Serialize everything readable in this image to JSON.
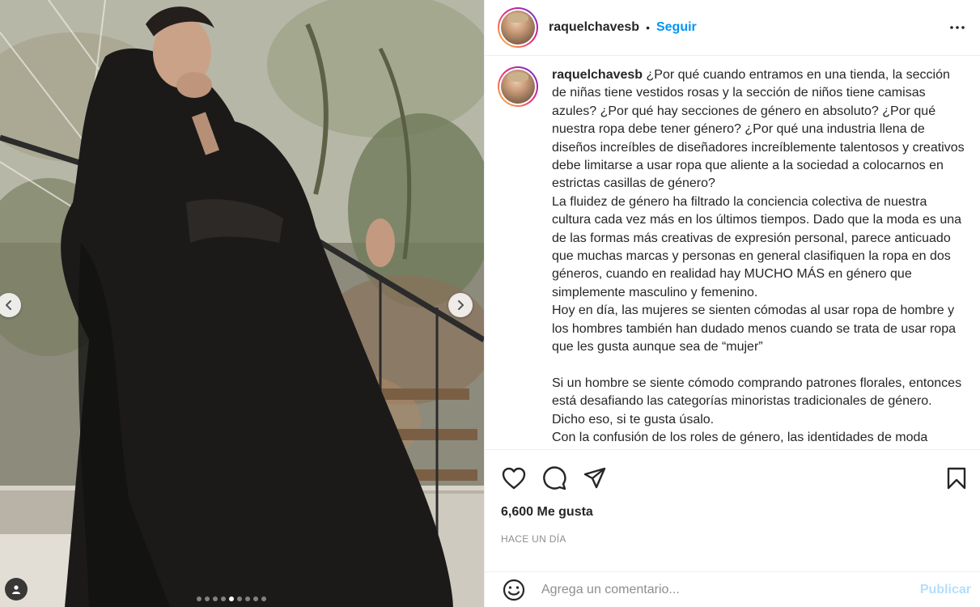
{
  "header": {
    "username": "raquelchavesb",
    "separator": "•",
    "follow_label": "Seguir"
  },
  "caption": {
    "username": "raquelchavesb",
    "text": "¿Por qué cuando entramos en una tienda, la sección de niñas tiene vestidos rosas y la sección de niños tiene camisas azules? ¿Por qué hay secciones de género en absoluto? ¿Por qué nuestra ropa debe tener género? ¿Por qué una industria llena de diseños increíbles de diseñadores increíblemente talentosos y creativos debe limitarse a usar ropa que aliente a la sociedad a colocarnos en estrictas casillas de género?\nLa fluidez de género ha filtrado la conciencia colectiva de nuestra cultura cada vez más en los últimos tiempos. Dado que la moda es una de las formas más creativas de expresión personal, parece anticuado que muchas marcas y personas en general clasifiquen la ropa en dos géneros, cuando en realidad hay MUCHO MÁS en género que simplemente masculino y femenino.\nHoy en día, las mujeres se sienten cómodas al usar ropa de hombre y los hombres también han dudado menos cuando se trata de usar ropa que les gusta aunque sea de “mujer”\n\nSi un hombre se siente cómodo comprando patrones florales, entonces está desafiando las categorías minoristas tradicionales de género. Dicho eso, si te gusta úsalo.\nCon la confusión de los roles de género, las identidades de moda"
  },
  "actions": {
    "icons": [
      "heart-icon",
      "comment-icon",
      "share-icon",
      "bookmark-icon"
    ]
  },
  "likes_text": "6,600 Me gusta",
  "timestamp": "HACE UN DÍA",
  "comment": {
    "placeholder": "Agrega un comentario...",
    "post_label": "Publicar"
  },
  "carousel": {
    "total": 9,
    "active_index": 4
  },
  "colors": {
    "accent": "#0095f6",
    "post_disabled": "#b2dffc",
    "muted": "#8e8e8e",
    "text": "#262626"
  }
}
